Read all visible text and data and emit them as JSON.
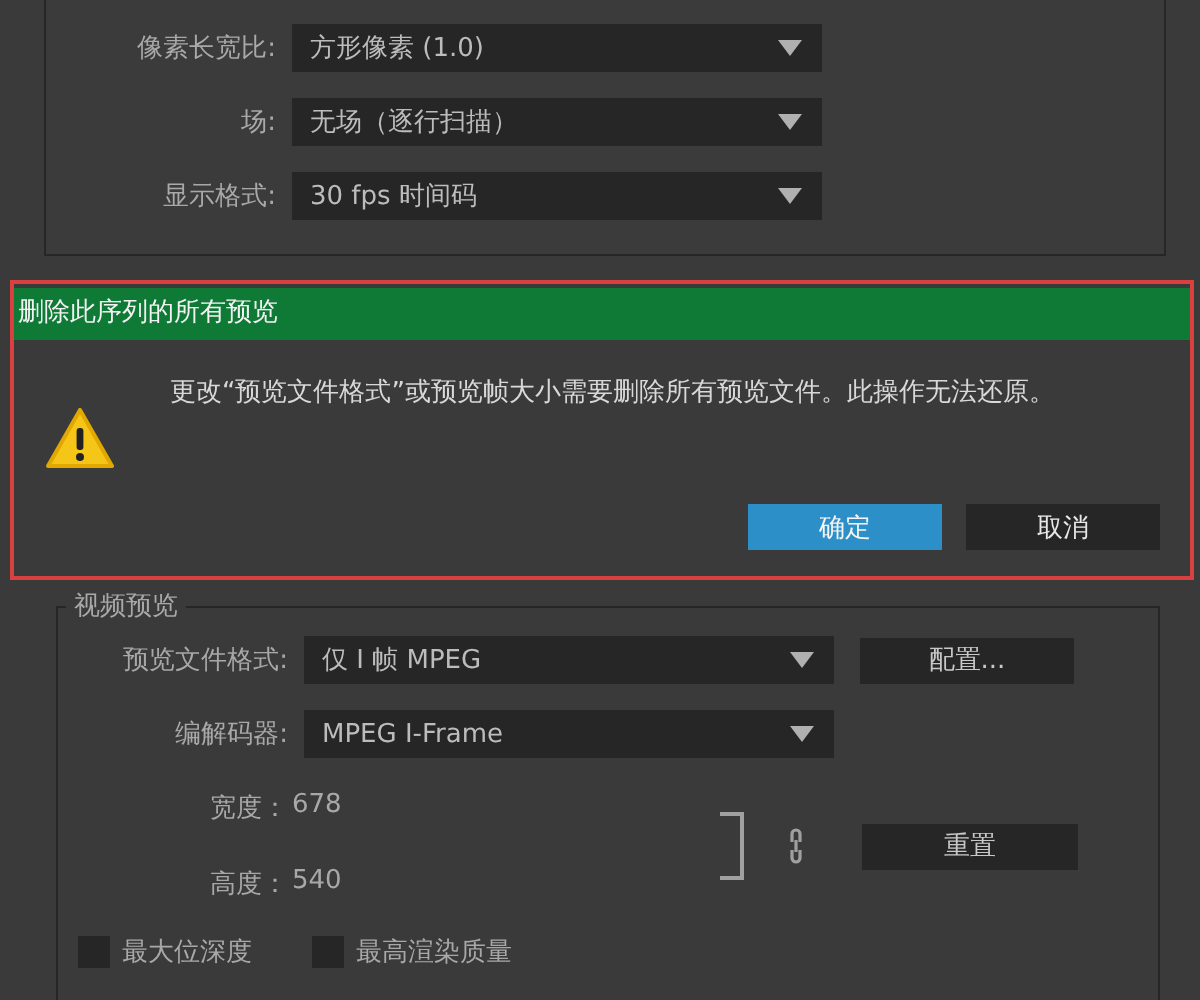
{
  "sequence_settings": {
    "fields": [
      {
        "label": "像素长宽比:",
        "value": "方形像素 (1.0)"
      },
      {
        "label": "场:",
        "value": "无场（逐行扫描）"
      },
      {
        "label": "显示格式:",
        "value": "30 fps 时间码"
      }
    ]
  },
  "dialog": {
    "title": "删除此序列的所有预览",
    "message": "更改“预览文件格式”或预览帧大小需要删除所有预览文件。此操作无法还原。",
    "buttons": [
      {
        "label": "确定",
        "selected": true
      },
      {
        "label": "取消",
        "selected": false
      }
    ]
  },
  "video_preview": {
    "title": "视频预览",
    "fields": [
      {
        "label": "预览文件格式:",
        "value": "仅 I 帧 MPEG",
        "button": "配置..."
      },
      {
        "label": "编解码器:",
        "value": "MPEG I-Frame"
      }
    ],
    "width": {
      "label": "宽度：",
      "value": "678"
    },
    "height": {
      "label": "高度：",
      "value": "540"
    },
    "reset_button": "重置",
    "checkboxes": [
      {
        "label": "最大位深度",
        "checked": false
      },
      {
        "label": "最高渲染质量",
        "checked": false
      }
    ]
  }
}
